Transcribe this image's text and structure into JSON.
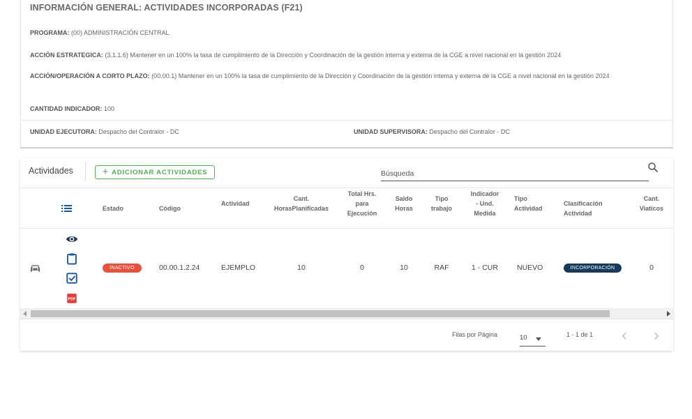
{
  "info": {
    "title": "INFORMACIÓN GENERAL: ACTIVIDADES INCORPORADAS (F21)",
    "programa_label": "PROGRAMA:",
    "programa_value": "(00) ADMINISTRACIÓN CENTRAL",
    "accion_label": "ACCIÓN ESTRATEGICA:",
    "accion_value": "(3.1.1.6) Mantener en un 100% la tasa de cumplimiento de la Dirección y Coordinación de la gestión interna y externa de la CGE a nivel nacional en la gestión 2024",
    "operacion_label": "ACCIÓN/OPERACIÓN A CORTO PLAZO:",
    "operacion_value": "(00.00.1) Mantener en un 100% la tasa de cumplimiento de la Dirección y Coordinación de la gestión interna y externa de la CGE a nivel nacional en la gestión 2024",
    "cantidad_label": "CANTIDAD INDICADOR:",
    "cantidad_value": "100",
    "ejecutora_label": "UNIDAD EJECUTORA:",
    "ejecutora_value": "Despacho del Contralor - DC",
    "supervisora_label": "UNIDAD SUPERVISORA:",
    "supervisora_value": "Despacho del Contralor - DC"
  },
  "activities": {
    "title": "Actividades",
    "add_button": "ADICIONAR ACTIVIDADES",
    "search_placeholder": "Búsqueda",
    "columns": {
      "estado": "Estado",
      "codigo": "Código",
      "actividad": "Actividad",
      "cant_horas_1": "Cant.",
      "cant_horas_2": "HorasPlanificadas",
      "total_hrs_1": "Total Hrs.",
      "total_hrs_2": "para",
      "total_hrs_3": "Ejecución",
      "saldo_1": "Saldo",
      "saldo_2": "Horas",
      "tipo_trabajo_1": "Tipo",
      "tipo_trabajo_2": "trabajo",
      "indicador_1": "Indicador",
      "indicador_2": "- Und.",
      "indicador_3": "Medida",
      "tipo_act_1": "Tipo",
      "tipo_act_2": "Actividad",
      "clasif_1": "Clasificación",
      "clasif_2": "Actividad",
      "viaticos_1": "Cant.",
      "viaticos_2": "Viaticos"
    },
    "rows": [
      {
        "estado": "INACTIVO",
        "codigo": "00.00.1.2.24",
        "actividad": "EJEMPLO",
        "cant_horas": "10",
        "total_hrs": "0",
        "saldo": "10",
        "tipo_trabajo": "RAF",
        "indicador": "1 - CUR",
        "tipo_actividad": "NUEVO",
        "clasificacion": "INCORPORACIÓN",
        "viaticos": "0"
      }
    ],
    "footer": {
      "rows_per_page_label": "Filas por Página",
      "rows_per_page_value": "10",
      "range": "1 - 1 de 1"
    }
  },
  "colors": {
    "accent_green": "#4caf50",
    "badge_inactive": "#e5533d",
    "badge_incorporacion": "#153a5b",
    "icon_blue": "#1a56a0",
    "icon_pdf": "#e53935"
  },
  "icons": [
    "list-icon",
    "car-icon",
    "eye-icon",
    "clipboard-icon",
    "checkbox-icon",
    "pdf-icon",
    "search-icon",
    "plus-icon",
    "chevron-left-icon",
    "chevron-right-icon"
  ]
}
